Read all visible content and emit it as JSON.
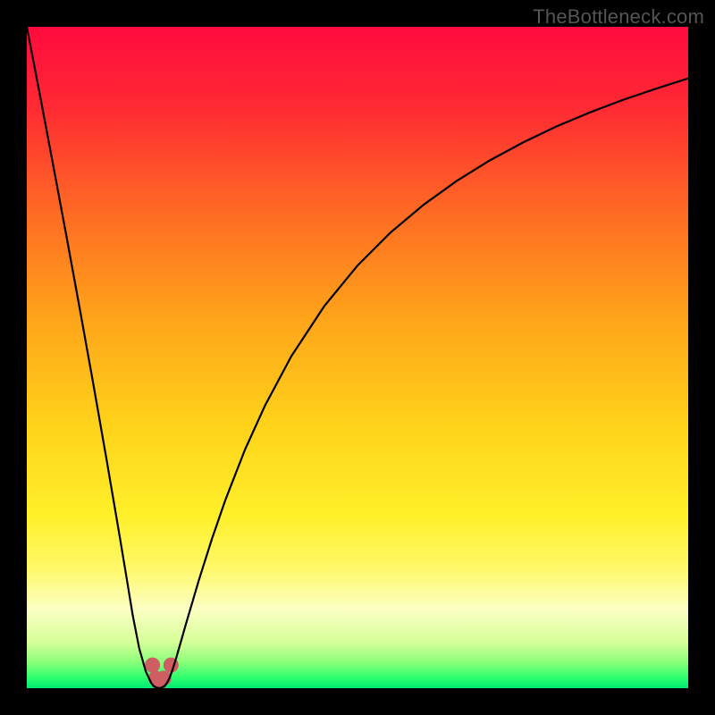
{
  "watermark": "TheBottleneck.com",
  "chart_data": {
    "type": "line",
    "title": "",
    "xlabel": "",
    "ylabel": "",
    "xlim": [
      0,
      100
    ],
    "ylim": [
      0,
      100
    ],
    "grid": false,
    "legend": false,
    "background_gradient": {
      "stops": [
        {
          "offset": 0.0,
          "color": "#ff0a3e"
        },
        {
          "offset": 0.12,
          "color": "#ff2a33"
        },
        {
          "offset": 0.28,
          "color": "#ff6a24"
        },
        {
          "offset": 0.44,
          "color": "#ffa41a"
        },
        {
          "offset": 0.6,
          "color": "#ffd21a"
        },
        {
          "offset": 0.74,
          "color": "#fff02a"
        },
        {
          "offset": 0.82,
          "color": "#fff86a"
        },
        {
          "offset": 0.88,
          "color": "#fcffc4"
        },
        {
          "offset": 0.93,
          "color": "#d6ff9a"
        },
        {
          "offset": 0.96,
          "color": "#8cff7a"
        },
        {
          "offset": 0.985,
          "color": "#2bff6e"
        },
        {
          "offset": 1.0,
          "color": "#00e874"
        }
      ]
    },
    "x": [
      0,
      2,
      4,
      6,
      8,
      10,
      12,
      14,
      15,
      16,
      17,
      18,
      18.8,
      19.2,
      19.6,
      20.0,
      20.4,
      20.8,
      21.2,
      21.6,
      22.0,
      22.6,
      23.2,
      24,
      26,
      28,
      30,
      33,
      36,
      40,
      45,
      50,
      55,
      60,
      65,
      70,
      75,
      80,
      85,
      90,
      95,
      100
    ],
    "series": [
      {
        "name": "curve",
        "color": "#000000",
        "values": [
          100.0,
          89.6,
          79.0,
          68.3,
          57.4,
          46.3,
          34.9,
          23.2,
          17.2,
          11.1,
          6.0,
          2.5,
          0.8,
          0.3,
          0.1,
          0.0,
          0.1,
          0.3,
          0.8,
          1.6,
          2.7,
          4.6,
          6.7,
          9.5,
          16.3,
          22.6,
          28.4,
          36.1,
          42.7,
          50.2,
          57.8,
          63.9,
          68.9,
          73.1,
          76.7,
          79.8,
          82.5,
          84.9,
          87.0,
          88.9,
          90.6,
          92.2
        ]
      }
    ],
    "marker": {
      "color": "#cf5e63",
      "points": [
        {
          "x": 19.0,
          "y": 3.5
        },
        {
          "x": 19.5,
          "y": 1.5
        },
        {
          "x": 20.0,
          "y": 0.8
        },
        {
          "x": 20.7,
          "y": 1.5
        },
        {
          "x": 21.8,
          "y": 3.5
        }
      ],
      "radius_percent": 1.15
    }
  }
}
